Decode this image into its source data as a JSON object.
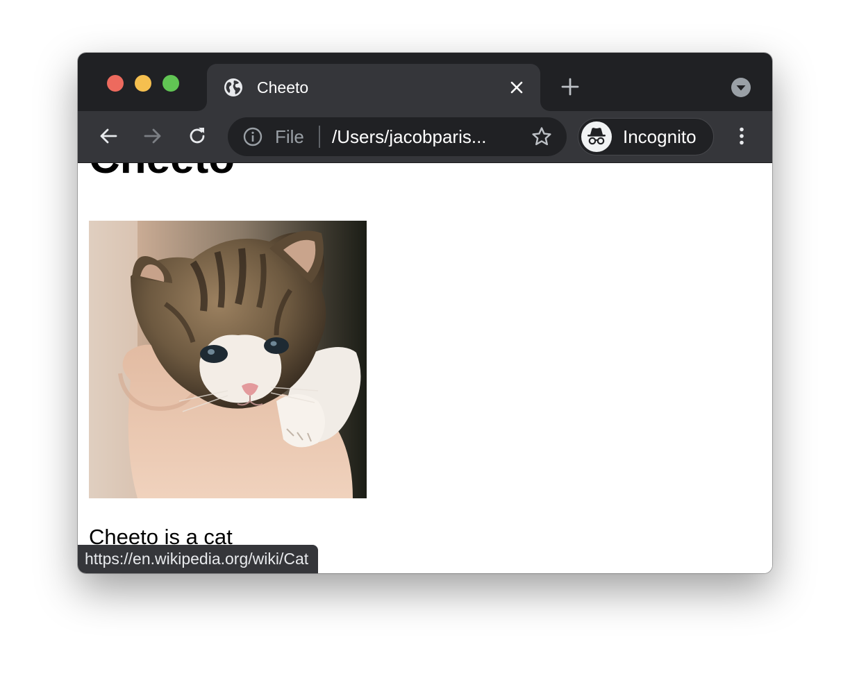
{
  "browser": {
    "tab": {
      "title": "Cheeto",
      "favicon_icon": "globe-icon",
      "close_icon": "close-icon"
    },
    "new_tab_icon": "plus-icon",
    "tab_search_icon": "chevron-down-icon",
    "toolbar": {
      "back_icon": "arrow-left-icon",
      "forward_icon": "arrow-right-icon",
      "reload_icon": "reload-icon",
      "omnibox": {
        "info_icon": "info-icon",
        "scheme_label": "File",
        "url_text": "/Users/jacobparis...",
        "bookmark_icon": "star-icon"
      },
      "profile": {
        "avatar_icon": "incognito-icon",
        "label": "Incognito"
      },
      "menu_icon": "kebab-menu-icon"
    },
    "status_bubble": {
      "url": "https://en.wikipedia.org/wiki/Cat"
    }
  },
  "page": {
    "heading": "Cheeto",
    "image_icon": "kitten-image",
    "paragraph": "Cheeto is a cat"
  },
  "colors": {
    "tabstrip_bg": "#202124",
    "toolbar_bg": "#35363a",
    "omnibox_bg": "#202124",
    "traffic_red": "#ed6a5e",
    "traffic_yellow": "#f5bf4f",
    "traffic_green": "#61c554"
  }
}
